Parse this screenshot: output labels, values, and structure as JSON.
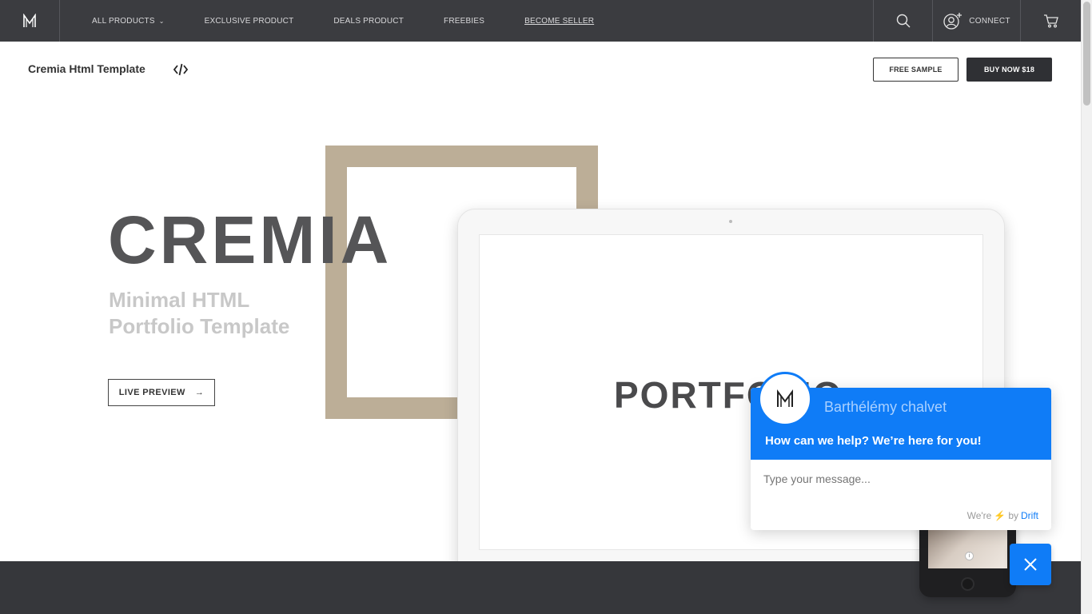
{
  "nav": {
    "logo_icon": "m-logo-icon",
    "links": [
      {
        "label": "ALL PRODUCTS",
        "has_caret": true
      },
      {
        "label": "EXCLUSIVE PRODUCT"
      },
      {
        "label": "DEALS PRODUCT"
      },
      {
        "label": "FREEBIES"
      },
      {
        "label": "BECOME SELLER",
        "underlined": true
      }
    ],
    "search_icon": "search-icon",
    "connect_label": "CONNECT",
    "connect_icon": "user-add-icon",
    "cart_icon": "cart-icon"
  },
  "product": {
    "title": "Cremia Html Template",
    "code_icon": "code-icon",
    "free_sample_label": "FREE SAMPLE",
    "buy_label": "BUY NOW $18"
  },
  "hero": {
    "title": "CREMIA",
    "subtitle_line1": "Minimal HTML",
    "subtitle_line2": "Portfolio Template",
    "preview_label": "LIVE PREVIEW",
    "preview_arrow": "→",
    "mockup_text": "PORTFOLIO"
  },
  "chat": {
    "agent_name": "Barthélémy chalvet",
    "help_text": "How can we help? We’re here for you!",
    "input_placeholder": "Type your message...",
    "footer_prefix": "We're",
    "footer_by": "by",
    "footer_brand": "Drift"
  },
  "colors": {
    "nav_bg": "#3b3c40",
    "accent_beige": "#bcae97",
    "chat_blue": "#0f7cf7",
    "dark_band": "#36373b"
  }
}
